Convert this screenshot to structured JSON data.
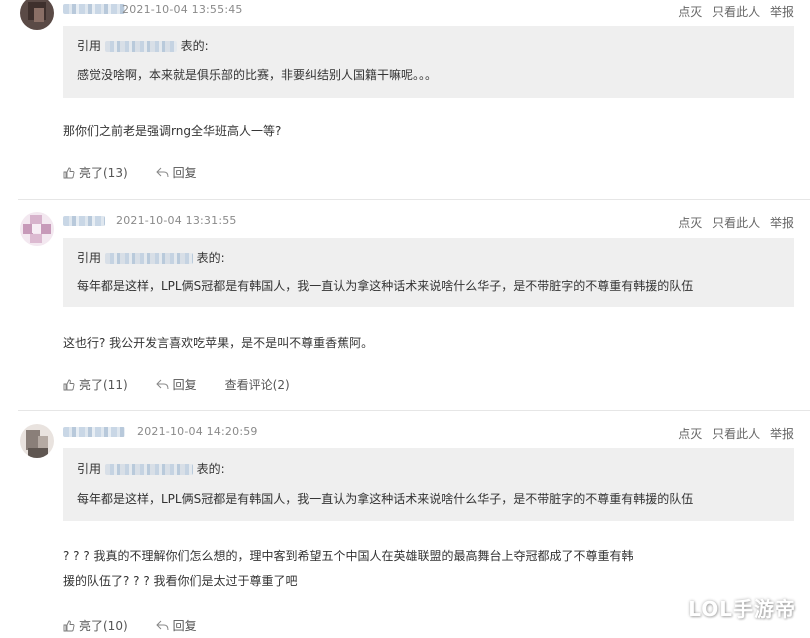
{
  "comments": [
    {
      "time": "2021-10-04 13:55:45",
      "actions": [
        "点灭",
        "只看此人",
        "举报"
      ],
      "quote": {
        "prefix": "引用",
        "suffix": "表的:",
        "body": "感觉没啥啊，本来就是俱乐部的比赛，非要纠结别人国籍干嘛呢。。。"
      },
      "text": "那你们之前老是强调rng全华班高人一等?",
      "like_label": "亮了(13)",
      "reply_label": "回复"
    },
    {
      "time": "2021-10-04 13:31:55",
      "actions": [
        "点灭",
        "只看此人",
        "举报"
      ],
      "quote": {
        "prefix": "引用",
        "suffix": "表的:",
        "body": "每年都是这样，LPL俩S冠都是有韩国人，我一直认为拿这种话术来说啥什么华子，是不带脏字的不尊重有韩援的队伍"
      },
      "text": "这也行? 我公开发言喜欢吃苹果，是不是叫不尊重香蕉阿。",
      "like_label": "亮了(11)",
      "reply_label": "回复",
      "view_replies_label": "查看评论(2)"
    },
    {
      "time": "2021-10-04 14:20:59",
      "actions": [
        "点灭",
        "只看此人",
        "举报"
      ],
      "quote": {
        "prefix": "引用",
        "suffix": "表的:",
        "body": "每年都是这样，LPL俩S冠都是有韩国人，我一直认为拿这种话术来说啥什么华子，是不带脏字的不尊重有韩援的队伍"
      },
      "text_lines": [
        "? ? ? 我真的不理解你们怎么想的，理中客到希望五个中国人在英雄联盟的最高舞台上夺冠都成了不尊重有韩",
        "援的队伍了? ? ? 我看你们是太过于尊重了吧"
      ],
      "like_label": "亮了(10)",
      "reply_label": "回复"
    }
  ],
  "watermark": "LOL手游帝",
  "colors": {
    "quote_bg": "#efefef",
    "divider": "#e6e6e6",
    "meta_text": "#8a8a8a"
  },
  "icons": {
    "like": "thumbs-up-icon",
    "reply": "reply-arrow-icon"
  }
}
